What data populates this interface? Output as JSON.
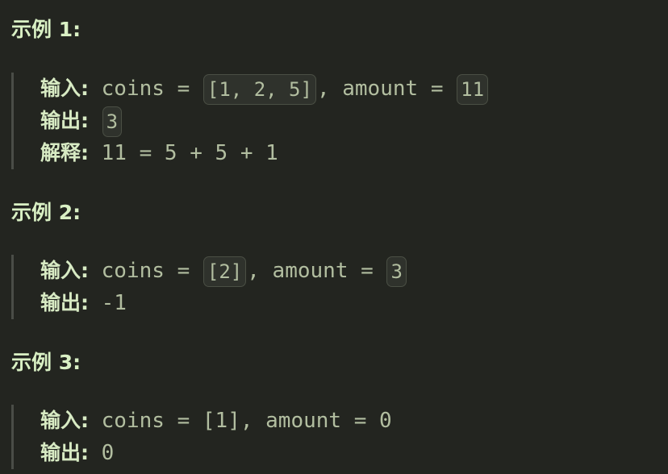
{
  "examples": [
    {
      "title": "示例 1:",
      "input_label": "输入:",
      "input_code_1": "coins = ",
      "input_inline_1": "[1, 2, 5]",
      "input_code_2": ", amount = ",
      "input_inline_2": "11",
      "output_label": "输出:",
      "output_value": "3",
      "explain_label": "解释:",
      "explain_value": "11 = 5 + 5 + 1"
    },
    {
      "title": "示例 2:",
      "input_label": "输入:",
      "input_code_1": "coins = ",
      "input_inline_1": "[2]",
      "input_code_2": ", amount = ",
      "input_inline_2": "3",
      "output_label": "输出:",
      "output_value": "-1"
    },
    {
      "title": "示例 3:",
      "input_label": "输入:",
      "input_value": "coins = [1], amount = 0",
      "output_label": "输出:",
      "output_value": "0"
    }
  ]
}
